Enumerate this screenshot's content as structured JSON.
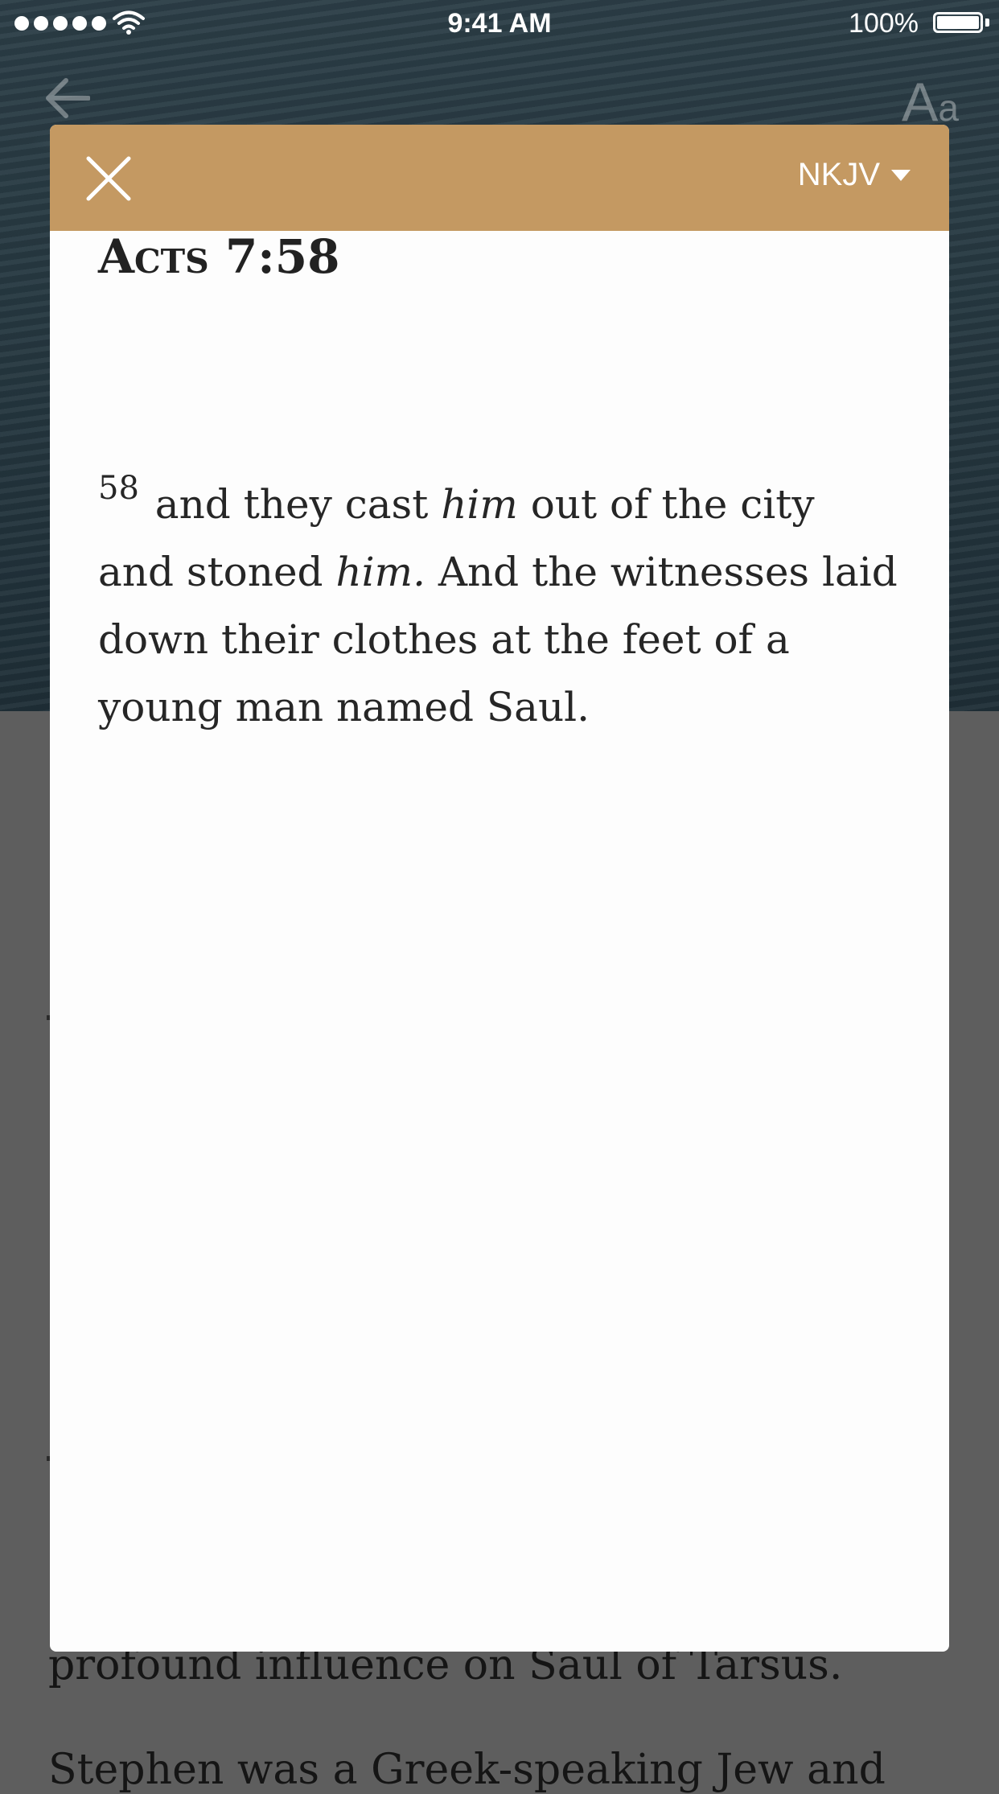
{
  "status_bar": {
    "time": "9:41 AM",
    "battery": "100%"
  },
  "nav": {
    "back_icon": "arrow-left-icon",
    "font_size_label_big": "A",
    "font_size_label_small": "a"
  },
  "background_text": {
    "line_1": "profound influence on Saul of Tarsus.",
    "line_2": "Stephen was a Greek-speaking Jew and"
  },
  "modal": {
    "close_icon": "close-icon",
    "version": "NKJV",
    "reference": "Acts 7:58",
    "verse_number": "58",
    "verse_parts": {
      "p1": " and they cast ",
      "p2": "him",
      "p3": " out of the city and stoned ",
      "p4": "him.",
      "p5": " And the witnesses laid down their clothes at the feet of a young man named Saul."
    }
  },
  "colors": {
    "header_accent": "#c49962",
    "overlay": "#5e5e5e",
    "modal_background": "#fdfdfd"
  }
}
